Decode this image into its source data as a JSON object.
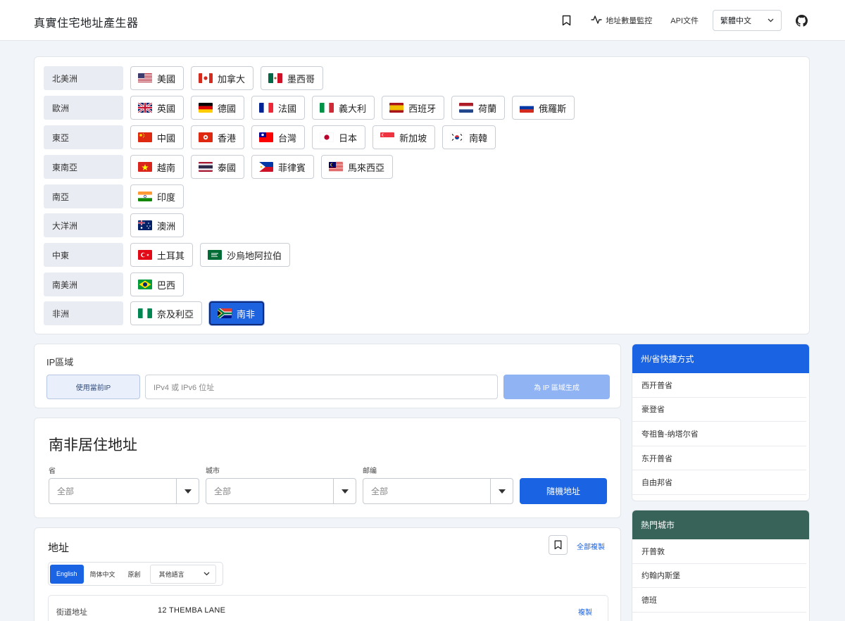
{
  "header": {
    "title": "真實住宅地址產生器",
    "monitor_label": "地址數量監控",
    "api_label": "API文件",
    "language": "繁體中文"
  },
  "regions": [
    {
      "label": "北美洲",
      "countries": [
        {
          "name": "美國",
          "flag": "us"
        },
        {
          "name": "加拿大",
          "flag": "ca"
        },
        {
          "name": "墨西哥",
          "flag": "mx"
        }
      ]
    },
    {
      "label": "歐洲",
      "countries": [
        {
          "name": "英國",
          "flag": "gb"
        },
        {
          "name": "德國",
          "flag": "de"
        },
        {
          "name": "法國",
          "flag": "fr"
        },
        {
          "name": "義大利",
          "flag": "it"
        },
        {
          "name": "西班牙",
          "flag": "es"
        },
        {
          "name": "荷蘭",
          "flag": "nl"
        },
        {
          "name": "俄羅斯",
          "flag": "ru"
        }
      ]
    },
    {
      "label": "東亞",
      "countries": [
        {
          "name": "中國",
          "flag": "cn"
        },
        {
          "name": "香港",
          "flag": "hk"
        },
        {
          "name": "台灣",
          "flag": "tw"
        },
        {
          "name": "日本",
          "flag": "jp"
        },
        {
          "name": "新加坡",
          "flag": "sg"
        },
        {
          "name": "南韓",
          "flag": "kr"
        }
      ]
    },
    {
      "label": "東南亞",
      "countries": [
        {
          "name": "越南",
          "flag": "vn"
        },
        {
          "name": "泰國",
          "flag": "th"
        },
        {
          "name": "菲律賓",
          "flag": "ph"
        },
        {
          "name": "馬來西亞",
          "flag": "my"
        }
      ]
    },
    {
      "label": "南亞",
      "countries": [
        {
          "name": "印度",
          "flag": "in"
        }
      ]
    },
    {
      "label": "大洋洲",
      "countries": [
        {
          "name": "澳洲",
          "flag": "au"
        }
      ]
    },
    {
      "label": "中東",
      "countries": [
        {
          "name": "土耳其",
          "flag": "tr"
        },
        {
          "name": "沙烏地阿拉伯",
          "flag": "sa"
        }
      ]
    },
    {
      "label": "南美洲",
      "countries": [
        {
          "name": "巴西",
          "flag": "br"
        }
      ]
    },
    {
      "label": "非洲",
      "countries": [
        {
          "name": "奈及利亞",
          "flag": "ng"
        },
        {
          "name": "南非",
          "flag": "za",
          "selected": true
        }
      ]
    }
  ],
  "ip": {
    "title": "IP區域",
    "use_current": "使用當前IP",
    "placeholder": "IPv4 或 IPv6 位址",
    "generate": "為 IP 區域生成"
  },
  "generator": {
    "title": "南非居住地址",
    "province_label": "省",
    "province_value": "全部",
    "city_label": "城市",
    "city_value": "全部",
    "zip_label": "邮编",
    "zip_value": "全部",
    "random_button": "隨機地址"
  },
  "address": {
    "title": "地址",
    "copy_all": "全部複製",
    "tabs": [
      "English",
      "简体中文",
      "原創"
    ],
    "active_tab": "English",
    "other_lang": "其他語言",
    "rows": [
      {
        "key": "街道地址",
        "value": "12 THEMBA LANE",
        "copy": "複製"
      }
    ]
  },
  "sidebar": {
    "provinces_title": "州/省快捷方式",
    "provinces": [
      "西开普省",
      "豪登省",
      "夸祖鲁-纳塔尔省",
      "东开普省",
      "自由邦省"
    ],
    "cities_title": "熱門城市",
    "cities": [
      "开普敦",
      "约翰内斯堡",
      "德班"
    ]
  },
  "colors": {
    "primary": "#1a63e3",
    "primary_light": "#8fb3f3",
    "teal_header": "#386359",
    "region_bg": "#e9ecf2"
  }
}
